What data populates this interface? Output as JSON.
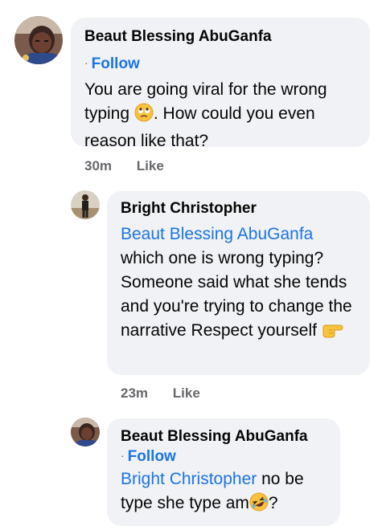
{
  "comments": [
    {
      "author": "Beaut Blessing AbuGanfa",
      "follow_label": "Follow",
      "text_part1": "You are going viral for the wrong typing",
      "text_part2": ". How could you even reason like that?",
      "time": "30m",
      "like_label": "Like",
      "emoji": "eye-roll-emoji"
    },
    {
      "author": "Bright Christopher",
      "mention": "Beaut Blessing AbuGanfa",
      "text": "which one is wrong typing? Someone said what she tends and you're trying to change the narrative Respect yourself",
      "time": "23m",
      "like_label": "Like",
      "emoji": "pointing-right-emoji"
    },
    {
      "author": "Beaut Blessing AbuGanfa",
      "follow_label": "Follow",
      "mention": "Bright Christopher",
      "text_part1": " no be type she type am",
      "text_part2": "?",
      "emoji": "rolling-laughing-emoji"
    }
  ],
  "colors": {
    "bubble": "#f0f2f5",
    "link": "#1b74e4",
    "meta": "#65676b"
  }
}
